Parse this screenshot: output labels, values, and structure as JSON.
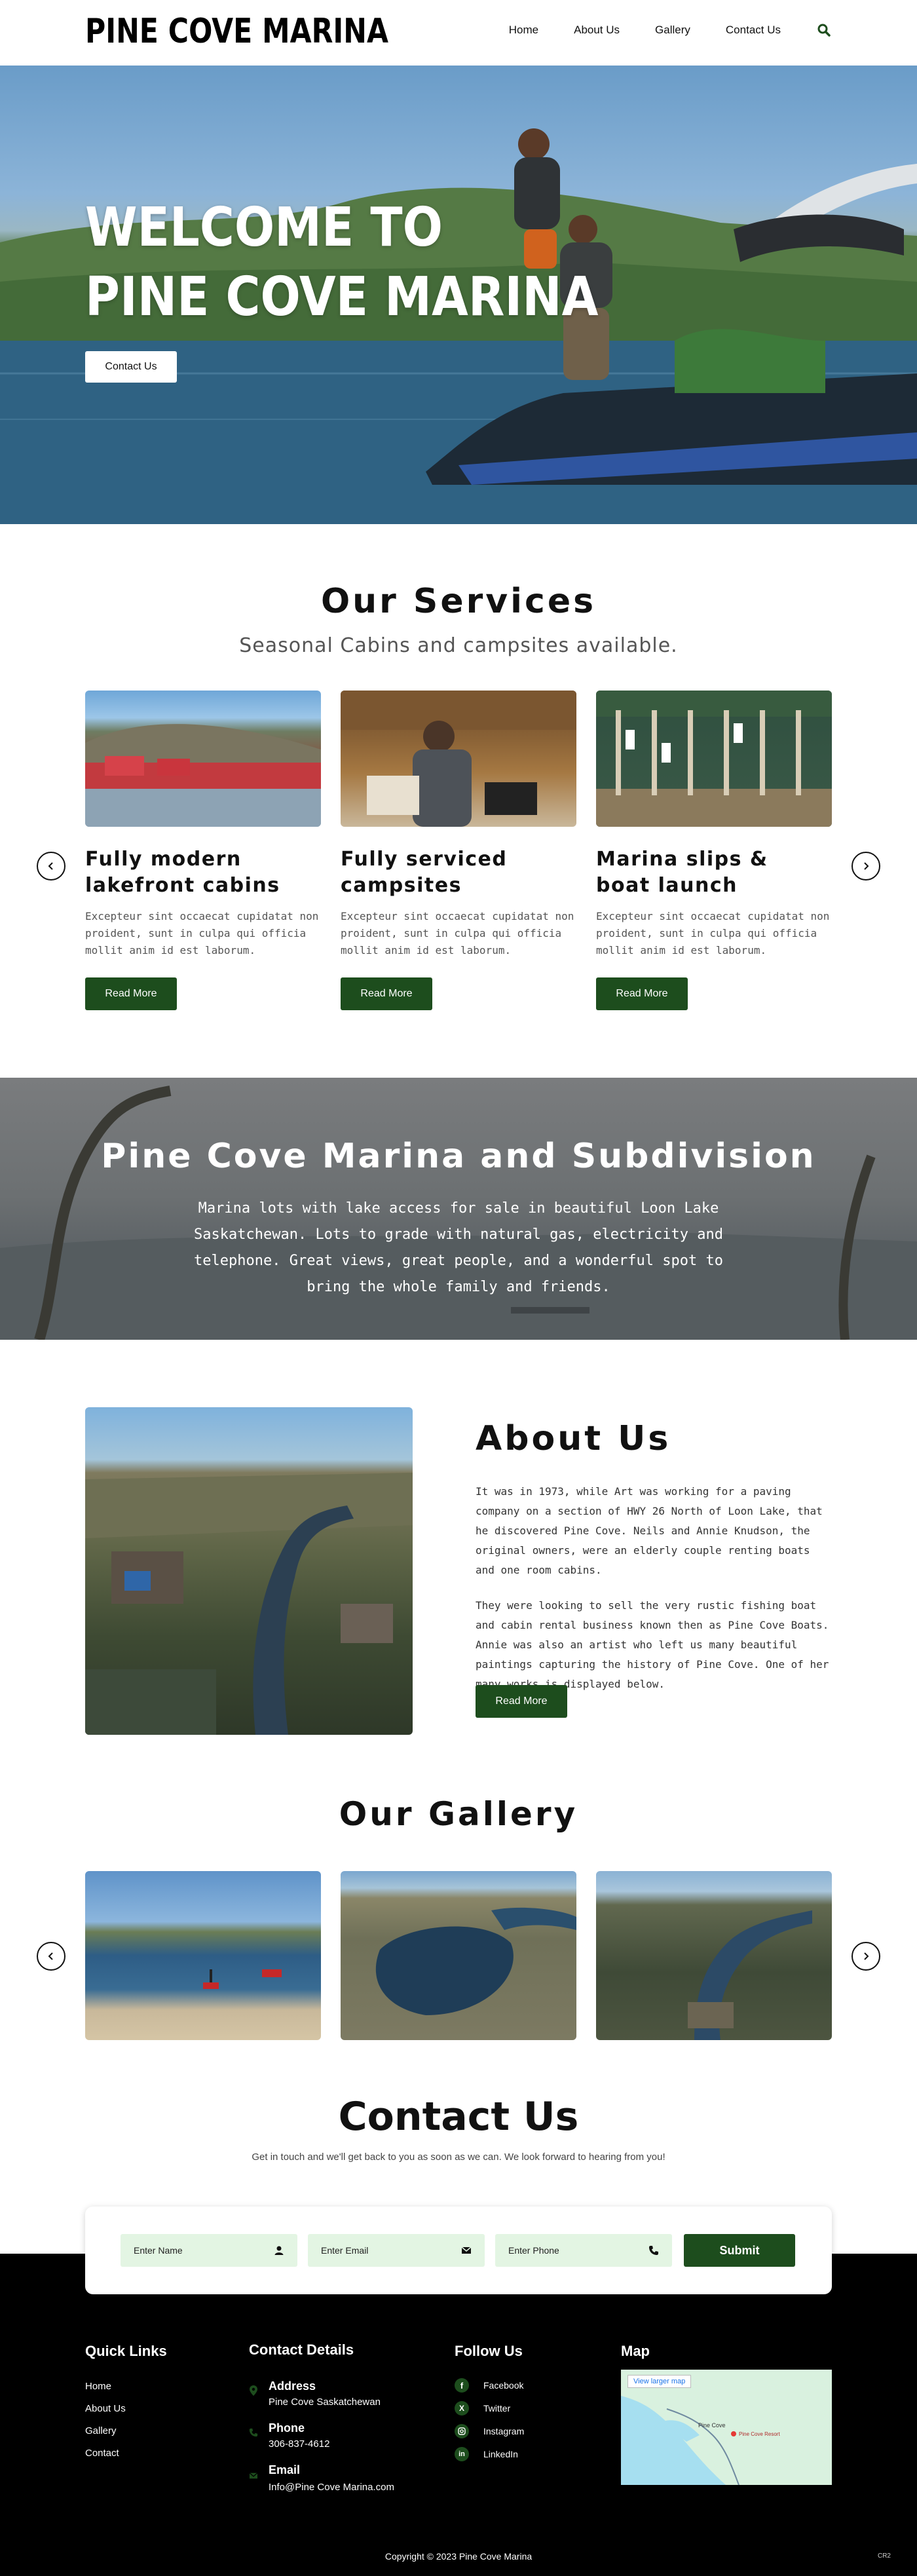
{
  "header": {
    "logo": "PINE COVE MARINA",
    "nav": [
      "Home",
      "About Us",
      "Gallery",
      "Contact Us"
    ],
    "search_icon": "search-icon"
  },
  "hero": {
    "title_line1": "WELCOME TO",
    "title_line2": "PINE COVE MARINA",
    "button": "Contact Us"
  },
  "services": {
    "title": "Our Services",
    "subtitle": "Seasonal Cabins and campsites available.",
    "cards": [
      {
        "title_line1": "Fully modern",
        "title_line2": "lakefront cabins",
        "desc": "Excepteur sint occaecat cupidatat non proident, sunt in culpa qui officia mollit anim id est laborum.",
        "button": "Read More"
      },
      {
        "title_line1": "Fully serviced",
        "title_line2": "campsites",
        "desc": "Excepteur sint occaecat cupidatat non proident, sunt in culpa qui officia mollit anim id est laborum.",
        "button": "Read More"
      },
      {
        "title_line1": "Marina slips &",
        "title_line2": "boat launch",
        "desc": "Excepteur sint occaecat cupidatat non proident, sunt in culpa qui officia mollit anim id est laborum.",
        "button": "Read More"
      }
    ]
  },
  "banner": {
    "title": "Pine Cove Marina and Subdivision",
    "text": "Marina lots with lake access for sale in beautiful Loon Lake Saskatchewan. Lots to grade with natural gas, electricity and telephone. Great views, great people, and a wonderful spot to bring the whole family and friends."
  },
  "about": {
    "title": "About Us",
    "p1": "It was in 1973, while Art was working for a paving company on a section of HWY 26 North of Loon Lake, that he discovered Pine Cove.  Neils and Annie Knudson, the original owners, were an elderly couple renting boats and one room cabins.",
    "p2": "They were looking to sell the very rustic fishing boat and cabin rental business known then as Pine Cove Boats.  Annie was also an artist who left us many beautiful paintings capturing the history of Pine Cove.  One of her many works is displayed below.",
    "button": "Read More"
  },
  "gallery": {
    "title": "Our Gallery"
  },
  "contact": {
    "title": "Contact Us",
    "subtitle": "Get in touch and we'll get back to you as soon as we can.  We look forward to hearing from you!",
    "name_placeholder": "Enter Name",
    "email_placeholder": "Enter Email",
    "phone_placeholder": "Enter Phone",
    "submit": "Submit"
  },
  "footer": {
    "quick_links_title": "Quick Links",
    "quick_links": [
      "Home",
      "About Us",
      "Gallery",
      "Contact"
    ],
    "contact_title": "Contact Details",
    "address_label": "Address",
    "address_value": "Pine Cove Saskatchewan",
    "phone_label": "Phone",
    "phone_value": "306-837-4612",
    "email_label": "Email",
    "email_value": "Info@Pine Cove Marina.com",
    "follow_title": "Follow Us",
    "social": [
      "Facebook",
      "Twitter",
      "Instagram",
      "LinkedIn"
    ],
    "map_title": "Map",
    "map_link": "View larger map",
    "map_place": "Pine Cove",
    "map_pin": "Pine Cove Resort",
    "copyright": "Copyright © 2023 Pine Cove Marina",
    "badge": "CR2"
  },
  "colors": {
    "accent_green": "#1d4d1d",
    "field_bg": "#e3f5e3"
  }
}
